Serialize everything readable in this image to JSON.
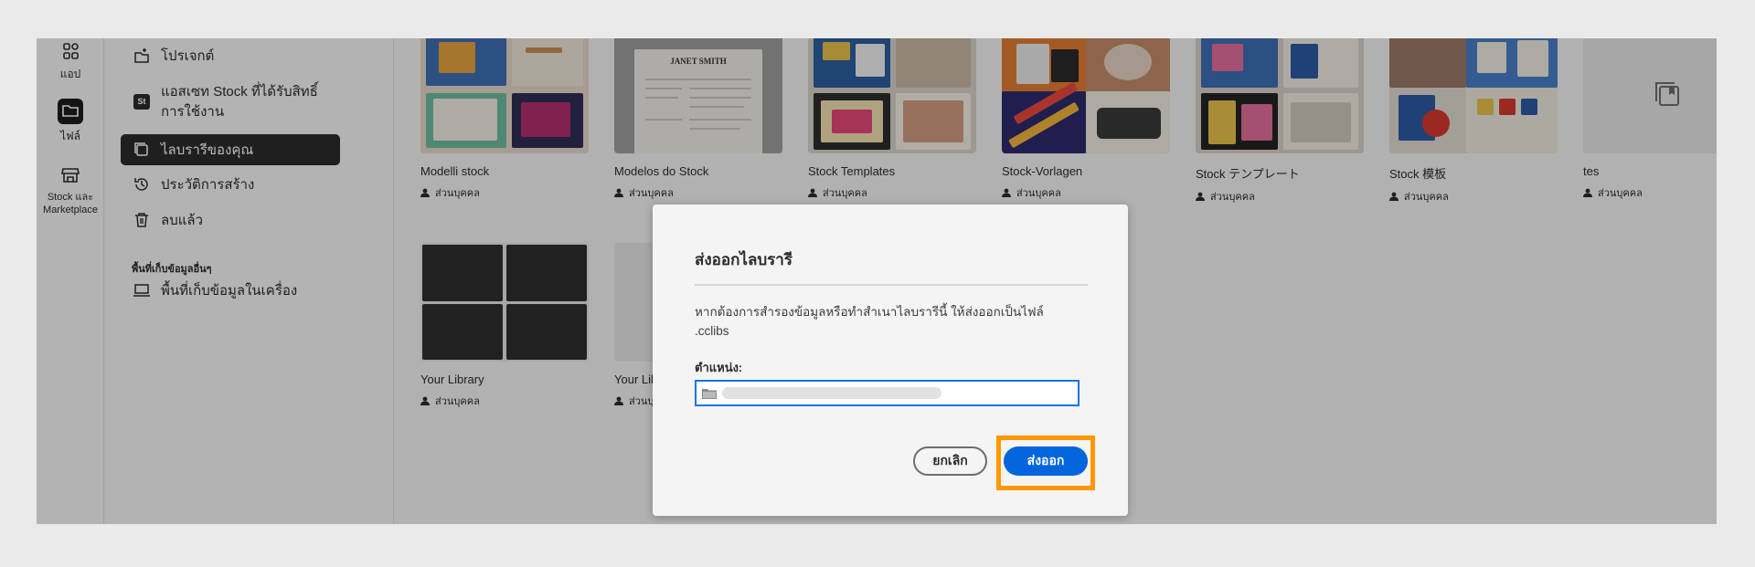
{
  "rail": {
    "apps_label": "แอป",
    "files_label": "ไฟล์",
    "stock_label_1": "Stock และ",
    "stock_label_2": "Marketplace"
  },
  "nav": {
    "projects": "โปรเจกต์",
    "stock_assets_1": "แอสเซท Stock ที่ได้รับสิทธิ์",
    "stock_assets_2": "การใช้งาน",
    "stock_badge": "St",
    "your_libraries": "ไลบรารีของคุณ",
    "history": "ประวัติการสร้าง",
    "deleted": "ลบแล้ว",
    "other_storage_heading": "พื้นที่เก็บข้อมูลอื่นๆ",
    "local_storage": "พื้นที่เก็บข้อมูลในเครื่อง"
  },
  "cards": [
    {
      "title": "Modelli stock",
      "meta": "ส่วนบุคคล"
    },
    {
      "title": "Modelos do Stock",
      "meta": "ส่วนบุคคล"
    },
    {
      "title": "Stock Templates",
      "meta": "ส่วนบุคคล"
    },
    {
      "title": "Stock-Vorlagen",
      "meta": "ส่วนบุคคล"
    },
    {
      "title": "Stock テンプレート",
      "meta": "ส่วนบุคคล"
    },
    {
      "title": "Stock 模板",
      "meta": "ส่วนบุคคล"
    },
    {
      "title": "tes",
      "meta": "ส่วนบุคคล"
    },
    {
      "title": "Your Library",
      "meta": "ส่วนบุคคล"
    },
    {
      "title": "Your Library",
      "meta": "ส่วนบุคคล"
    }
  ],
  "resume_name": "JANET SMITH",
  "dialog": {
    "title": "ส่งออกไลบรารี",
    "body_line1": "หากต้องการสำรองข้อมูลหรือทำสำเนาไลบรารีนี้ ให้ส่งออกเป็นไฟล์",
    "body_line2": ".cclibs",
    "location_label": "ตำแหน่ง:",
    "cancel": "ยกเลิก",
    "export": "ส่งออก"
  },
  "colors": {
    "accent": "#0265dc",
    "highlight": "#ff9800",
    "field_border": "#1473e6",
    "active_nav": "#2c2c2c"
  }
}
